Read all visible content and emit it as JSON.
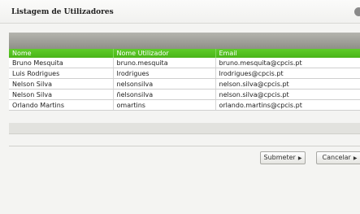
{
  "window": {
    "title": "Listagem de Utilizadores"
  },
  "table": {
    "columns": [
      "Nome",
      "Nome Utilizador",
      "Email"
    ],
    "rows": [
      [
        "Bruno Mesquita",
        "bruno.mesquita",
        "bruno.mesquita@cpcis.pt"
      ],
      [
        "Luis Rodrigues",
        "lrodrigues",
        "lrodrigues@cpcis.pt"
      ],
      [
        "Nelson Silva",
        "nelsonsilva",
        "nelson.silva@cpcis.pt"
      ],
      [
        "Nelson Silva",
        "ñelsonsilva",
        "nelson.silva@cpcis.pt"
      ],
      [
        "Orlando Martins",
        "omartins",
        "orlando.martins@cpcis.pt"
      ]
    ]
  },
  "buttons": {
    "submit": "Submeter",
    "cancel": "Cancelar"
  },
  "icons": {
    "button_arrow": "▶"
  }
}
